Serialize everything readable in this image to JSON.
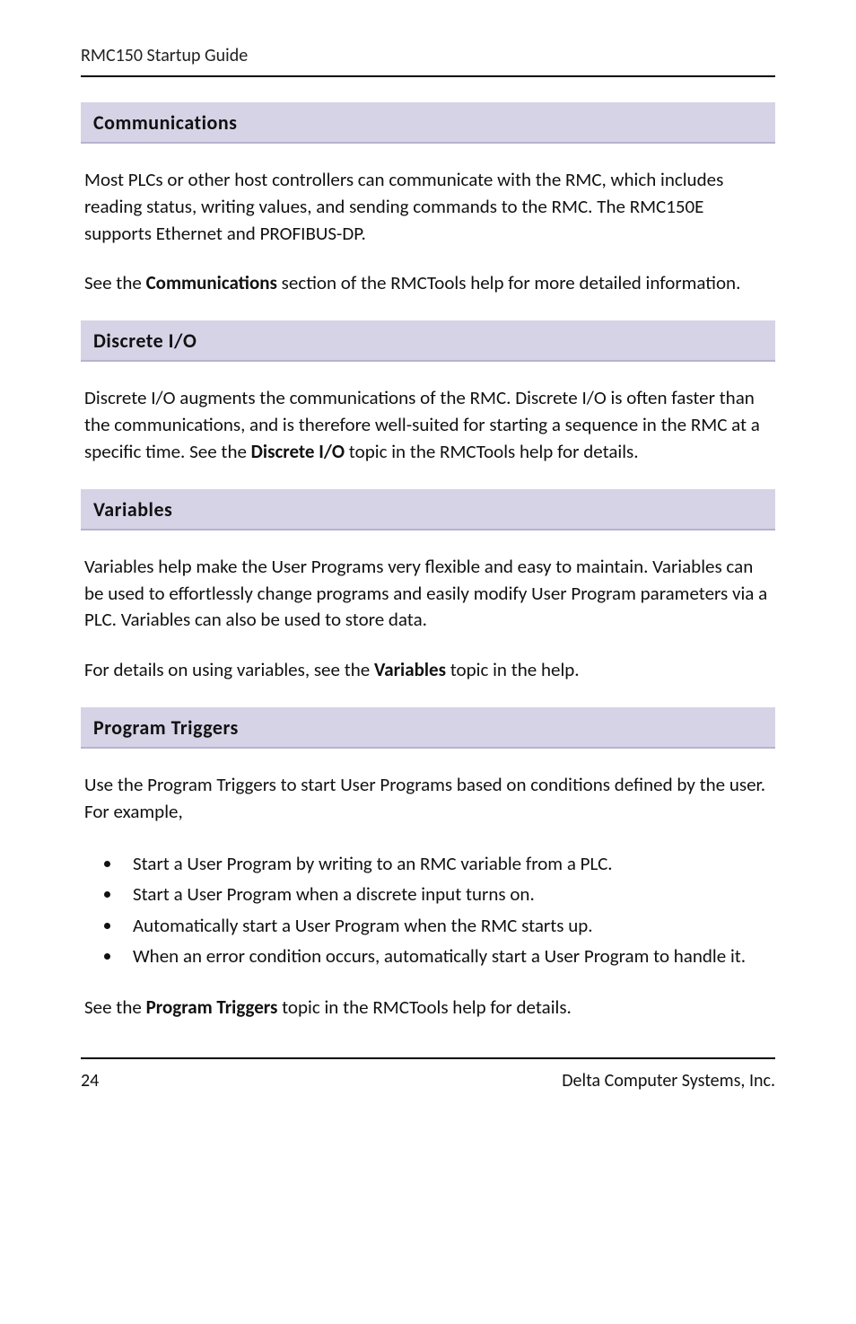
{
  "header": {
    "running_title": "RMC150 Startup Guide"
  },
  "sections": {
    "communications": {
      "heading": "Communications",
      "p1": "Most PLCs or other host controllers can communicate with the RMC, which includes reading status, writing values, and sending commands to the RMC. The RMC150E supports Ethernet and PROFIBUS-DP.",
      "p2_pre": "See the ",
      "p2_bold": "Communications",
      "p2_post": " section of the RMCTools help for more detailed information."
    },
    "discrete_io": {
      "heading": "Discrete I/O",
      "p1_pre": "Discrete I/O augments the communications of the RMC. Discrete I/O is often faster than the communications, and is therefore well-suited for starting a sequence in the RMC at a specific time. See the ",
      "p1_bold": "Discrete I/O",
      "p1_post": " topic in the RMCTools help for details."
    },
    "variables": {
      "heading": "Variables",
      "p1": "Variables help make the User Programs very flexible and easy to maintain. Variables can be used to effortlessly change programs and easily modify User Program parameters via a PLC. Variables can also be used to store data.",
      "p2_pre": "For details on using variables, see the ",
      "p2_bold": "Variables",
      "p2_post": " topic in the help."
    },
    "program_triggers": {
      "heading": "Program Triggers",
      "p1": "Use the Program Triggers to start User Programs based on conditions defined by the user. For example,",
      "bullets": [
        "Start a User Program by writing to an RMC variable from a PLC.",
        "Start a User Program when a discrete input turns on.",
        "Automatically start a User Program when the RMC starts up.",
        "When an error condition occurs, automatically start a User Program to handle it."
      ],
      "p2_pre": "See the ",
      "p2_bold": "Program Triggers",
      "p2_post": " topic in the RMCTools help for details."
    }
  },
  "footer": {
    "page_number": "24",
    "company": "Delta Computer Systems, Inc."
  }
}
